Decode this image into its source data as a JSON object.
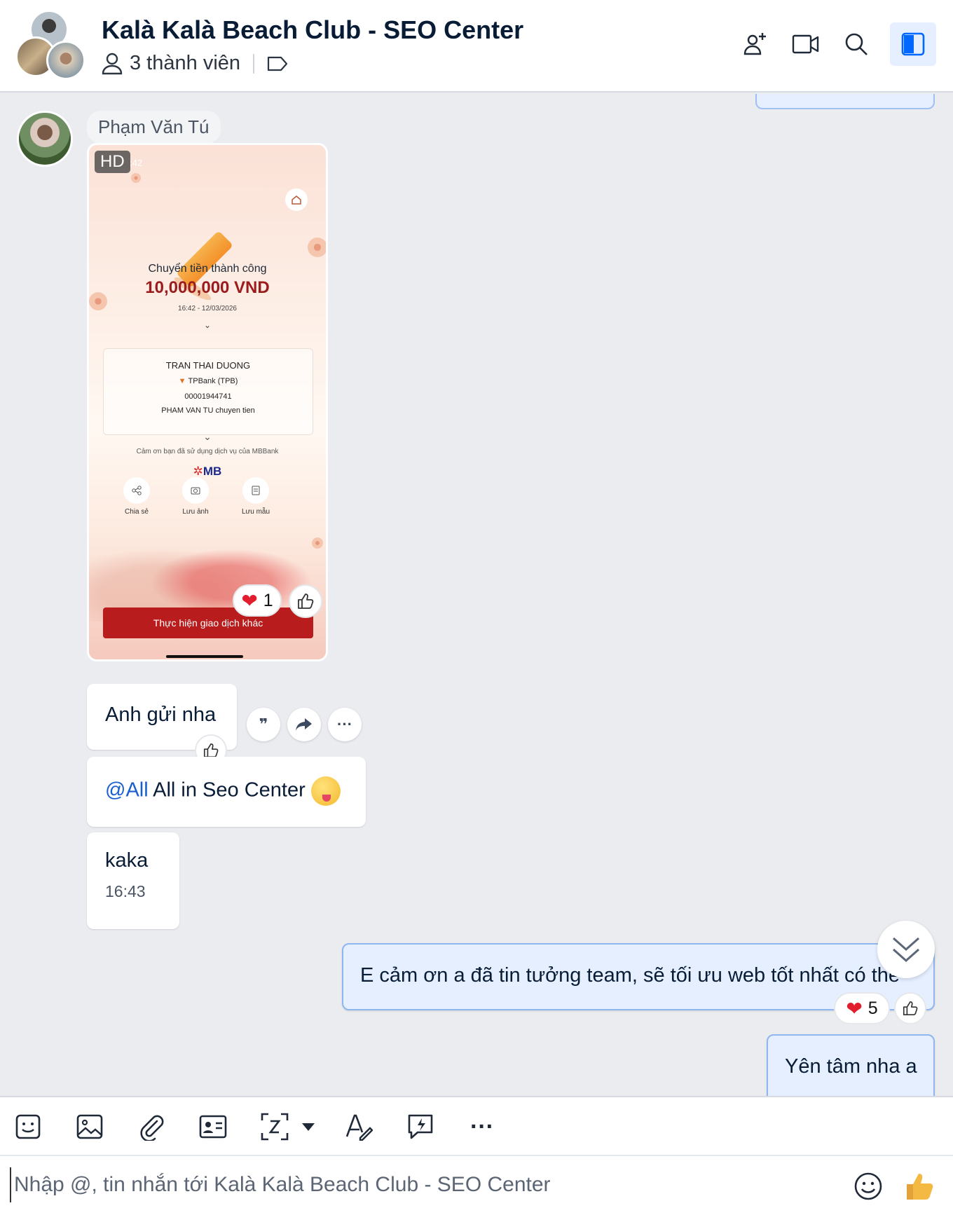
{
  "header": {
    "title": "Kalà Kalà Beach Club - SEO Center",
    "members_label": "3 thành viên",
    "icons": [
      "add-member-icon",
      "video-call-icon",
      "search-icon",
      "sidebar-toggle-icon"
    ]
  },
  "messages": {
    "sender_name": "Phạm Văn Tú",
    "image": {
      "hd_badge": "HD",
      "time_fragment": ":42",
      "status": "Chuyển tiền thành công",
      "amount": "10,000,000 VND",
      "datetime": "16:42 - 12/03/2026",
      "recipient_name": "TRAN THAI DUONG",
      "bank": "TPBank (TPB)",
      "account": "00001944741",
      "note": "PHAM VAN TU chuyen tien",
      "thanks": "Cảm ơn bạn đã sử dụng dịch vụ của MBBank",
      "brand": "MB",
      "actions": [
        "Chia sẻ",
        "Lưu ảnh",
        "Lưu mẫu"
      ],
      "cta": "Thực hiện giao dịch khác",
      "reaction_count": "1"
    },
    "msg1": "Anh gửi nha",
    "msg2_mention": "@All",
    "msg2_text": " All in Seo Center",
    "msg3": "kaka",
    "msg3_time": "16:43",
    "mine1": "E cảm ơn a đã tin tưởng team, sẽ tối ưu web tốt nhất có thể",
    "mine1_reaction_count": "5",
    "mine2": "Yên tâm nha a"
  },
  "toolbar": {
    "icons": [
      "sticker-icon",
      "image-icon",
      "attachment-icon",
      "contact-card-icon",
      "screenshot-icon",
      "dropdown-icon",
      "text-format-icon",
      "quick-message-icon",
      "more-icon"
    ]
  },
  "input": {
    "placeholder": "Nhập @, tin nhắn tới Kalà Kalà Beach Club - SEO Center"
  },
  "colors": {
    "accent": "#1a5fd0",
    "my_bubble": "#e5efff",
    "heart": "#e11d2e"
  }
}
